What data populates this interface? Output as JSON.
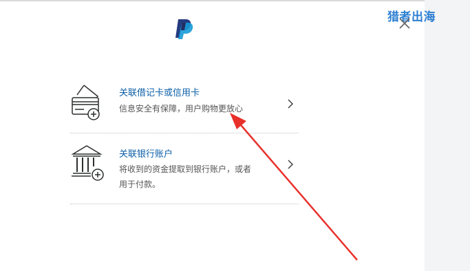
{
  "watermark": {
    "text": "猎者出海"
  },
  "header": {
    "logo_icon": "paypal-logo-icon",
    "close_icon": "close-icon"
  },
  "options": [
    {
      "title": "关联借记卡或信用卡",
      "description": "信息安全有保障，用户购物更放心",
      "icon": "credit-card-add-icon",
      "chevron": "chevron-right-icon"
    },
    {
      "title": "关联银行账户",
      "description_line1": "将收到的资金提取到银行账户，或者",
      "description_line2": "用于付款。",
      "icon": "bank-add-icon",
      "chevron": "chevron-right-icon"
    }
  ],
  "annotation": {
    "icon": "red-arrow-icon",
    "color": "#e8302b"
  },
  "colors": {
    "link": "#0c5fa8",
    "paypal_dark": "#253b80",
    "paypal_light": "#179bd7",
    "watermark": "#2d7fd2"
  }
}
